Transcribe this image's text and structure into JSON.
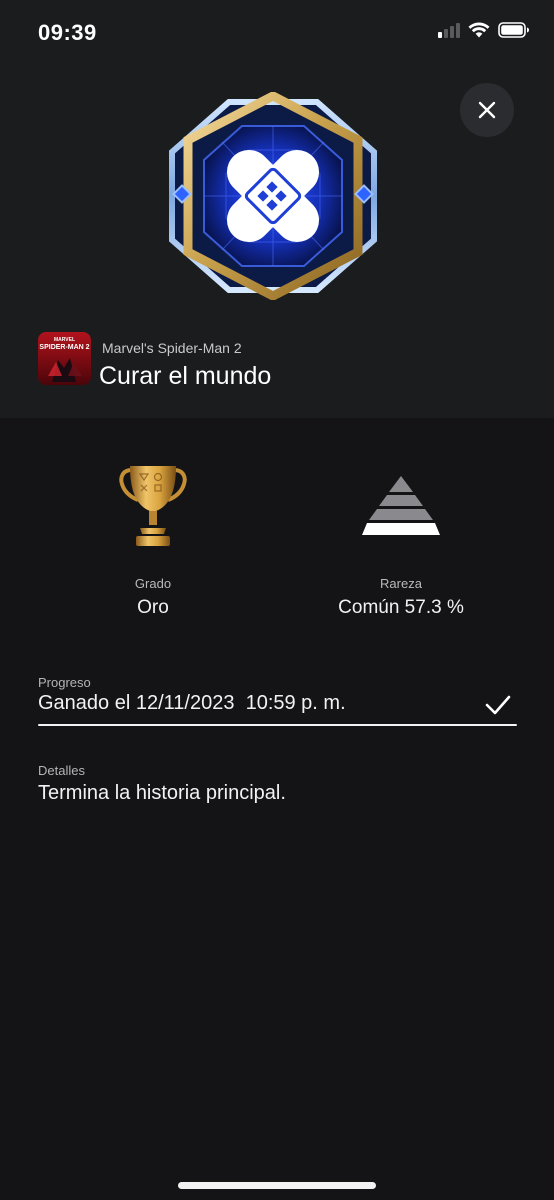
{
  "status_bar": {
    "time": "09:39",
    "icons": [
      "cellular-signal-icon",
      "wifi-icon",
      "battery-icon"
    ]
  },
  "header": {
    "close_icon": "close-icon",
    "badge_icon": "trophy-badge-bandage-icon"
  },
  "game": {
    "name": "Marvel's Spider-Man 2",
    "icon_text_top": "MARVEL",
    "icon_text": "SPIDER-MAN 2"
  },
  "trophy": {
    "title": "Curar el mundo"
  },
  "stats": {
    "grade_label": "Grado",
    "grade_value": "Oro",
    "grade_icon": "gold-trophy-icon",
    "rarity_label": "Rareza",
    "rarity_value": "Común 57.3 %",
    "rarity_icon": "rarity-pyramid-icon"
  },
  "progress": {
    "label": "Progreso",
    "value": "Ganado el 12/11/2023  10:59 p. m.",
    "check_icon": "checkmark-icon"
  },
  "details": {
    "label": "Detalles",
    "value": "Termina la historia principal."
  },
  "colors": {
    "background": "#141416",
    "header_background": "#1b1c1e",
    "gold": "#c9a24d",
    "badge_blue": "#1f3fd6",
    "text_primary": "#f2f2f3",
    "text_secondary": "#b4b4b7"
  }
}
